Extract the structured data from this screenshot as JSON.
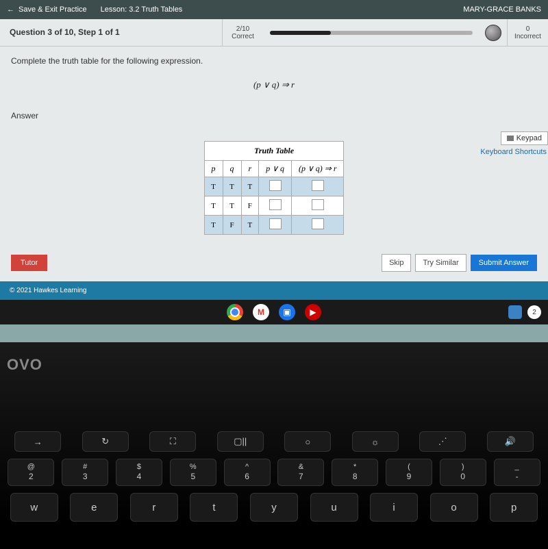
{
  "topbar": {
    "back_arrow": "←",
    "save_exit": "Save & Exit Practice",
    "lesson": "Lesson: 3.2 Truth Tables",
    "user": "MARY-GRACE BANKS"
  },
  "header": {
    "question_title": "Question 3 of 10,  Step 1 of 1",
    "progress_num": "2/10",
    "progress_label": "Correct",
    "incorrect_num": "0",
    "incorrect_label": "Incorrect"
  },
  "instruction": "Complete the truth table for the following expression.",
  "expression": "(p ∨ q) ⇒ r",
  "answer_label": "Answer",
  "tools": {
    "keypad": "Keypad",
    "shortcuts": "Keyboard Shortcuts"
  },
  "table": {
    "title": "Truth Table",
    "headers": [
      "p",
      "q",
      "r",
      "p ∨ q",
      "(p ∨ q) ⇒ r"
    ],
    "rows": [
      {
        "vals": [
          "T",
          "T",
          "T"
        ],
        "cls": "rowblue"
      },
      {
        "vals": [
          "T",
          "T",
          "F"
        ],
        "cls": "rowwhite"
      },
      {
        "vals": [
          "T",
          "F",
          "T"
        ],
        "cls": "rowblue"
      }
    ]
  },
  "buttons": {
    "tutor": "Tutor",
    "skip": "Skip",
    "try_similar": "Try Similar",
    "submit": "Submit Answer"
  },
  "footer": "© 2021 Hawkes Learning",
  "taskbar": {
    "gmail": "M",
    "docs": "▣",
    "yt": "▶",
    "num": "2"
  },
  "brand": "OVO",
  "keys_r1": [
    "→",
    "↻",
    "⛶",
    "▢||",
    "○",
    "☼",
    "⋰",
    "🔊"
  ],
  "keys_r2": [
    {
      "up": "@",
      "dn": "2"
    },
    {
      "up": "#",
      "dn": "3"
    },
    {
      "up": "$",
      "dn": "4"
    },
    {
      "up": "%",
      "dn": "5"
    },
    {
      "up": "^",
      "dn": "6"
    },
    {
      "up": "&",
      "dn": "7"
    },
    {
      "up": "*",
      "dn": "8"
    },
    {
      "up": "(",
      "dn": "9"
    },
    {
      "up": ")",
      "dn": "0"
    },
    {
      "up": "_",
      "dn": "-"
    }
  ],
  "keys_r3": [
    "w",
    "e",
    "r",
    "t",
    "y",
    "u",
    "i",
    "o",
    "p"
  ]
}
